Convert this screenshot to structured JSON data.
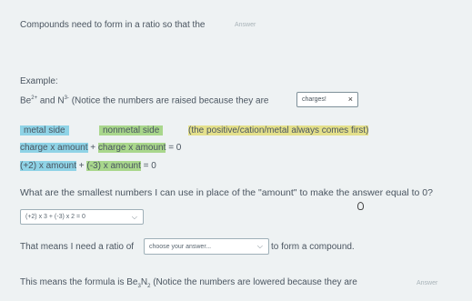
{
  "prompt": {
    "text": "Compounds need to form in a ratio so that the",
    "answer_placeholder": "Answer"
  },
  "example": {
    "label": "Example:",
    "ion1_base": "Be",
    "ion1_charge": "2+",
    "and": "and",
    "ion2_base": "N",
    "ion2_charge": "3-",
    "notice": "(Notice the numbers are raised because they are",
    "chip_value": "charges!"
  },
  "legend": {
    "metal": "metal side",
    "nonmetal": "nonmetal side",
    "note": "(the positive/cation/metal always comes first)"
  },
  "formula_general": {
    "part1": "charge x amount",
    "plus": "+",
    "part2": "charge x amount",
    "eq": "= 0"
  },
  "formula_specific": {
    "part1": "(+2) x amount",
    "plus": "+",
    "part2": "(-3) x amount",
    "eq": "= 0"
  },
  "question": "What are the smallest numbers I can use in place of the \"amount\" to make the answer equal to 0?",
  "equation_dropdown": {
    "value": "(+2) x 3 + (-3) x 2 = 0"
  },
  "ratio_line": {
    "before": "That means I need a ratio of",
    "dropdown_placeholder": "choose your answer...",
    "after": "to form a compound."
  },
  "final_line": {
    "before": "This means the formula is Be",
    "sub1": "3",
    "mid": "N",
    "sub2": "2",
    "after": "(Notice the numbers are lowered because they are",
    "answer_placeholder": "Answer"
  },
  "colors": {
    "metal_highlight": "#8fd3e6",
    "nonmetal_highlight": "#a9d78c",
    "note_highlight": "#e4e08b"
  }
}
